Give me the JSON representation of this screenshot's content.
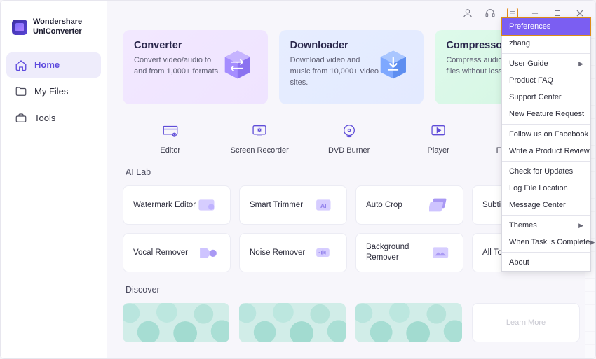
{
  "brand": {
    "line1": "Wondershare",
    "line2": "UniConverter"
  },
  "sidebar": {
    "items": [
      {
        "label": "Home"
      },
      {
        "label": "My Files"
      },
      {
        "label": "Tools"
      }
    ]
  },
  "promos": [
    {
      "title": "Converter",
      "desc": "Convert video/audio to and from 1,000+ formats."
    },
    {
      "title": "Downloader",
      "desc": "Download video and music from 10,000+ video sites."
    },
    {
      "title": "Compressor",
      "desc": "Compress audio/video files without loss of quality."
    }
  ],
  "tools": [
    {
      "label": "Editor"
    },
    {
      "label": "Screen Recorder"
    },
    {
      "label": "DVD Burner"
    },
    {
      "label": "Player"
    },
    {
      "label": "Fix Media Metadata"
    }
  ],
  "sections": {
    "ai": "AI Lab",
    "discover": "Discover"
  },
  "ai_items": [
    {
      "label": "Watermark Editor"
    },
    {
      "label": "Smart Trimmer"
    },
    {
      "label": "Auto Crop"
    },
    {
      "label": "Subtitle Editor"
    },
    {
      "label": "Vocal Remover"
    },
    {
      "label": "Noise Remover"
    },
    {
      "label": "Background Remover"
    },
    {
      "label": "All Tools"
    }
  ],
  "discover": {
    "more": "Learn More"
  },
  "menu": {
    "items": [
      {
        "label": "Preferences",
        "highlight": true
      },
      {
        "label": "zhang"
      },
      {
        "label": "User Guide",
        "arrow": true,
        "sep_before": true
      },
      {
        "label": "Product FAQ"
      },
      {
        "label": "Support Center"
      },
      {
        "label": "New Feature Request"
      },
      {
        "label": "Follow us on Facebook",
        "sep_before": true
      },
      {
        "label": "Write a Product Review"
      },
      {
        "label": "Check for Updates",
        "sep_before": true
      },
      {
        "label": "Log File Location"
      },
      {
        "label": "Message Center"
      },
      {
        "label": "Themes",
        "arrow": true,
        "sep_before": true
      },
      {
        "label": "When Task is Complete",
        "arrow": true
      },
      {
        "label": "About",
        "sep_before": true
      }
    ]
  }
}
